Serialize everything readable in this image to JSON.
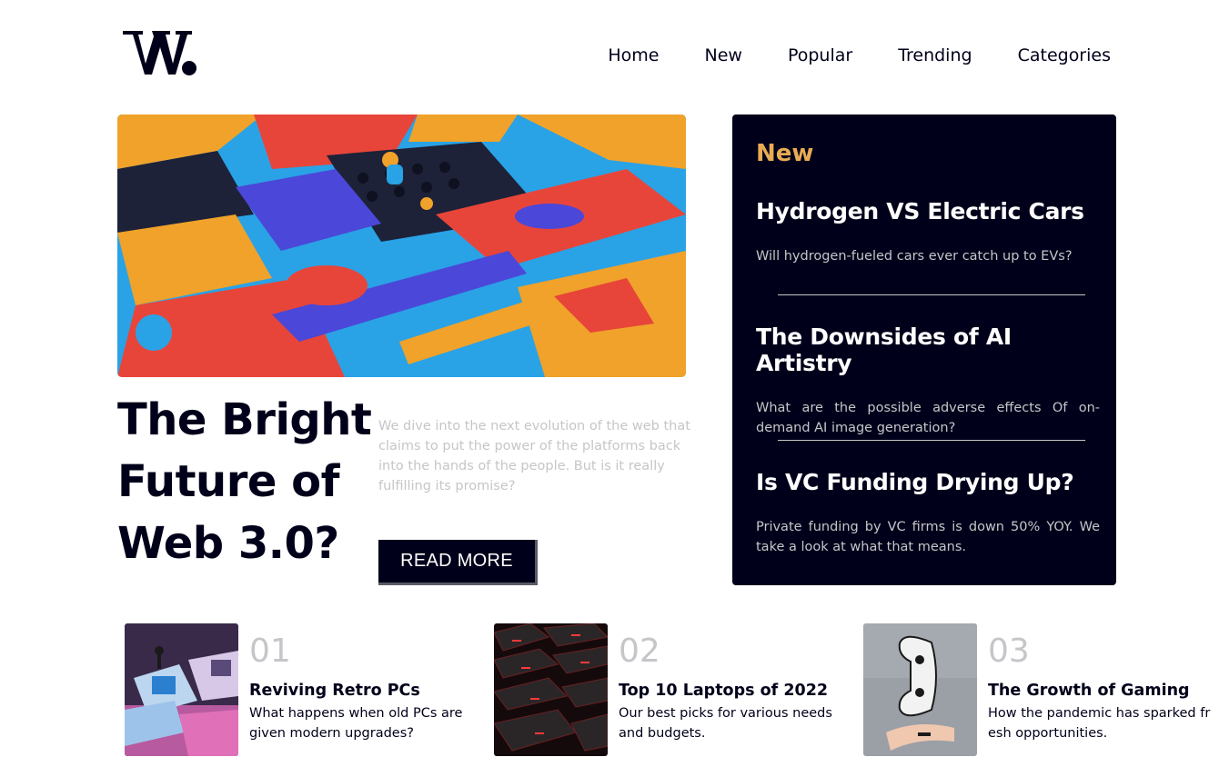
{
  "brand": {
    "logo_text": "W."
  },
  "nav": {
    "items": [
      {
        "label": "Home"
      },
      {
        "label": "New"
      },
      {
        "label": "Popular"
      },
      {
        "label": "Trending"
      },
      {
        "label": "Categories"
      }
    ]
  },
  "hero": {
    "title": "The Bright Future of Web 3.0?",
    "description": "We dive into the next evolution of the web that claims to put the power of the platforms back into the hands of the people. But is it really fulfilling its promise?",
    "button_label": "READ MORE"
  },
  "new_panel": {
    "heading": "New",
    "items": [
      {
        "title": "Hydrogen VS Electric Cars",
        "summary": "Will hydrogen-fueled cars ever catch up to EVs?"
      },
      {
        "title": "The Downsides of AI Artistry",
        "summary": "What are the possible adverse effects Of on-demand AI image generation?"
      },
      {
        "title": "Is VC Funding Drying Up?",
        "summary": "Private funding by VC firms is down 50% YOY. We take a look at what that means."
      }
    ]
  },
  "bottom": {
    "items": [
      {
        "number": "01",
        "title": "Reviving Retro PCs",
        "summary": "What happens when old PCs are given modern upgrades?"
      },
      {
        "number": "02",
        "title": "Top 10 Laptops of 2022",
        "summary": "Our best picks for various needs and budgets."
      },
      {
        "number": "03",
        "title": "The Growth of Gaming",
        "summary": "How the pandemic has sparked fr esh opportunities."
      }
    ]
  },
  "colors": {
    "dark": "#00001a",
    "accent": "#e9ab53",
    "muted": "#c5c6c9",
    "white": "#ffffff"
  }
}
